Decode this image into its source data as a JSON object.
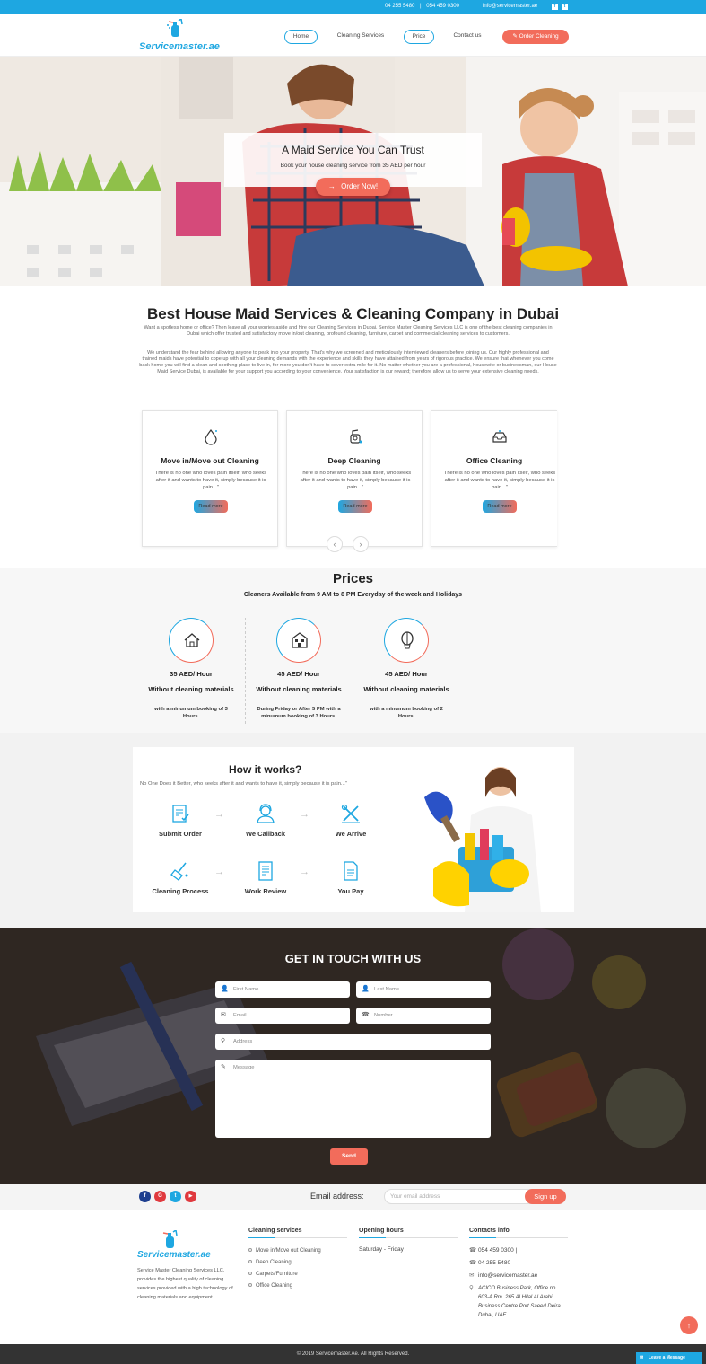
{
  "topbar": {
    "phone1": "04 255 5480",
    "sep": "|",
    "phone2": "054 459 0300",
    "email": "info@servicemaster.ae",
    "facebook_glyph": "f",
    "twitter_glyph": "t"
  },
  "header": {
    "logo_text": "Servicemaster.ae",
    "nav": [
      "Home",
      "Cleaning Services",
      "Price",
      "Contact us",
      "Order Cleaning"
    ]
  },
  "hero": {
    "title": "A Maid Service You Can Trust",
    "subtitle": "Book your house cleaning service from 35 AED per hour",
    "cta": "Order Now!",
    "cta_icon": "→"
  },
  "services": {
    "title": "Best House Maid Services & Cleaning Company in Dubai",
    "intro1": "Want a spotless home or office? Then leave all your worries aside and hire our Cleaning Services in Dubai. Service Master Cleaning Services LLC is one of the best cleaning companies in Dubai which offer trusted and satisfactory move in/out cleaning, profound cleaning, furniture, carpet and commercial cleaning services to customers.",
    "intro2": "We understand the fear behind allowing anyone to peak into your property. That's why we screened and meticulously interviewed cleaners before joining us. Our highly professional and trained maids have potential to cope up with all your cleaning demands with the experience and skills they have attained from years of rigorous practice. We ensure that whenever you come back home you will find a clean and soothing place to live in, for more you don't have to cover extra mile for it. No matter whether you are a professional, housewife or businessman, our House Maid Service Dubai, is available for your support you according to your convenience. Your satisfaction is our reward; therefore allow us to serve your extensive cleaning needs.",
    "cards": [
      {
        "title": "Move in/Move out Cleaning",
        "text": "There is no one who loves pain itself, who seeks after it and wants to have it, simply because it is pain...\"",
        "button": "Read more"
      },
      {
        "title": "Deep Cleaning",
        "text": "There is no one who loves pain itself, who seeks after it and wants to have it, simply because it is pain...\"",
        "button": "Read more"
      },
      {
        "title": "Office Cleaning",
        "text": "There is no one who loves pain itself, who seeks after it and wants to have it, simply because it is pain...\"",
        "button": "Read more"
      }
    ],
    "prev": "‹",
    "next": "›"
  },
  "prices": {
    "title": "Prices",
    "subtitle": "Cleaners Available from 9 AM to 8 PM Everyday of the week and Holidays",
    "plans": [
      {
        "amount": "35 AED/ Hour",
        "materials": "Without cleaning materials",
        "note": "with a minumum booking of 3 Hours."
      },
      {
        "amount": "45 AED/ Hour",
        "materials": "Without cleaning materials",
        "note": "During Friday or After 5 PM with a minumum booking of 3 Hours."
      },
      {
        "amount": "45 AED/ Hour",
        "materials": "Without cleaning materials",
        "note": "with a minumum booking of 2 Hours."
      }
    ]
  },
  "how": {
    "title": "How it works?",
    "lead": "No One Does it Better, who seeks after it and wants to have it, simply because it is pain...\"",
    "steps": [
      "Submit Order",
      "We Callback",
      "We Arrive",
      "Cleaning Process",
      "Work Review",
      "You Pay"
    ],
    "arrow": "→"
  },
  "contact": {
    "title": "GET IN TOUCH WITH US",
    "first_name": "First Name",
    "last_name": "Last Name",
    "email": "Email",
    "number": "Number",
    "address": "Address",
    "message": "Message",
    "send": "Send"
  },
  "subscribe": {
    "social": [
      "f",
      "G",
      "t",
      "▶"
    ],
    "label": "Email address:",
    "placeholder": "Your email address",
    "button": "Sign up"
  },
  "footer": {
    "logo_text": "Servicemaster.ae",
    "description": "Service Master Cleaning Services LLC. provides the highest quality of cleaning services provided with a high technology of cleaning materials and equipment.",
    "services_title": "Cleaning services",
    "services": [
      "Move in/Move out Cleaning",
      "Deep Cleaning",
      "Carpets/Furniture",
      "Office Cleaning"
    ],
    "hours_title": "Opening hours",
    "hours": "Saturday - Friday",
    "contacts_title": "Contacts info",
    "contact_phone1": "054 459 0300 |",
    "contact_phone2": "04 255 5480",
    "contact_email": "info@servicemaster.ae",
    "contact_address": "ACICO Business Park, Office no. 603-A Rm. 265 Al Hilal Al Arabi Business Centre Port Saeed Deira Dubai, UAE",
    "copyright": "© 2019 Servicemaster.Ae. All Rights Reserved.",
    "leave_message": "Leave a Message",
    "to_top": "↑"
  },
  "colors": {
    "primary": "#1ea7e1",
    "accent": "#f26c5b"
  }
}
